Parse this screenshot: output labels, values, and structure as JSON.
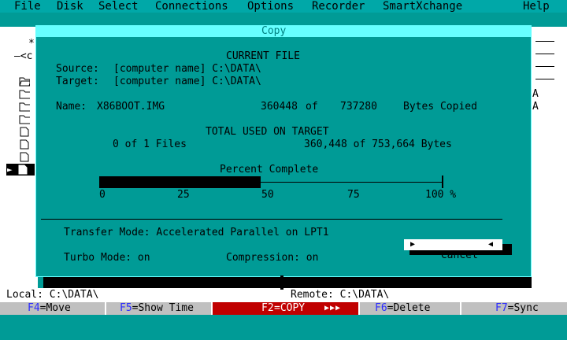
{
  "menu": [
    "File",
    "Disk",
    "Select",
    "Connections",
    "Options",
    "Recorder",
    "SmartXchange",
    "Help"
  ],
  "left_pane": {
    "frag1": "*",
    "frag2": "—<c"
  },
  "right_pane": {
    "frag1": "A",
    "frag2": "A"
  },
  "dialog": {
    "title": "Copy",
    "current_heading": "CURRENT FILE",
    "source_label": "Source:",
    "source_value": "[computer name] C:\\DATA\\",
    "target_label": "Target:",
    "target_value": "[computer name] C:\\DATA\\",
    "name_label": "Name:",
    "file_name": "X86BOOT.IMG",
    "bytes_copied": "360448",
    "of_word": "of",
    "bytes_total": "737280",
    "bytes_suffix": "Bytes Copied",
    "total_heading": "TOTAL USED ON TARGET",
    "files_text": "0 of 1 Files",
    "bytes_text": "360,448 of 753,664 Bytes",
    "percent_heading": "Percent Complete",
    "percent_value": 0.47,
    "scale": [
      "0",
      "25",
      "50",
      "75",
      "100 %"
    ],
    "transfer_mode": "Transfer Mode: Accelerated Parallel on LPT1",
    "turbo_mode": "Turbo Mode: on",
    "compression": "Compression: on",
    "cancel_label": "Cancel"
  },
  "status": {
    "local": "Local: C:\\DATA\\",
    "remote": "Remote: C:\\DATA\\"
  },
  "fkeys": [
    {
      "key": "F4",
      "label": "=Move"
    },
    {
      "key": "F5",
      "label": "=Show Time"
    },
    {
      "key": "F2",
      "label": "=COPY"
    },
    {
      "key": "F6",
      "label": "=Delete"
    },
    {
      "key": "F7",
      "label": "=Sync"
    }
  ],
  "colors": {
    "background": "#009b96",
    "title_bar": "#66ffff",
    "copy_key": "#c00000",
    "fkey_number": "#2b2bff"
  }
}
